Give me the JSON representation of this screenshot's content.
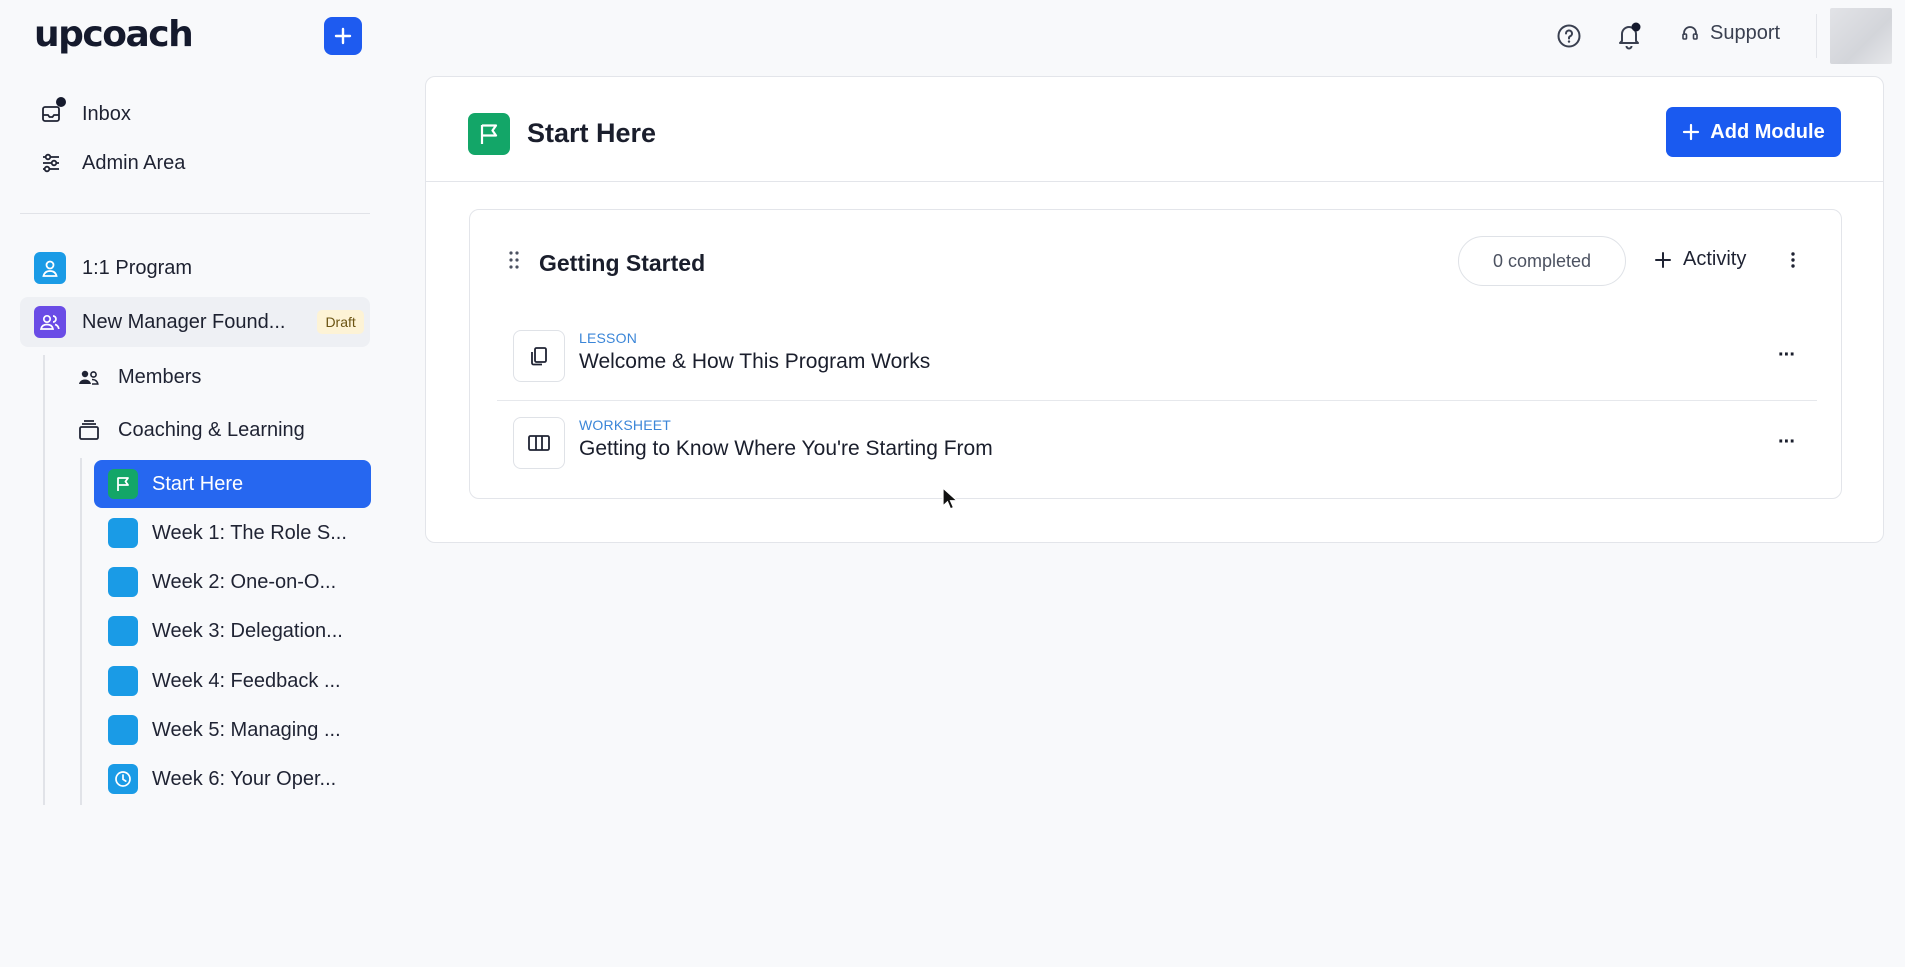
{
  "brand": {
    "logo": "upcoach"
  },
  "topbar": {
    "support_label": "Support"
  },
  "sidebar": {
    "nav": [
      {
        "label": "Inbox",
        "icon": "inbox-icon"
      },
      {
        "label": "Admin Area",
        "icon": "sliders-icon"
      }
    ],
    "programs": [
      {
        "label": "1:1 Program",
        "icon": "user-icon",
        "color": "#1a9be6"
      },
      {
        "label": "New Manager Found...",
        "icon": "users-icon",
        "color": "#6a4ce6",
        "badge": "Draft"
      }
    ],
    "sub": [
      {
        "label": "Members",
        "icon": "members-icon"
      },
      {
        "label": "Coaching & Learning",
        "icon": "stack-icon"
      }
    ],
    "weeks": [
      {
        "label": "Start Here",
        "icon": "flag-icon",
        "color": "#13a668"
      },
      {
        "label": "Week 1: The Role S...",
        "color": "#1a9be6"
      },
      {
        "label": "Week 2: One-on-O...",
        "color": "#1a9be6"
      },
      {
        "label": "Week 3: Delegation...",
        "color": "#1a9be6"
      },
      {
        "label": "Week 4: Feedback ...",
        "color": "#1a9be6"
      },
      {
        "label": "Week 5: Managing ...",
        "color": "#1a9be6"
      },
      {
        "label": "Week 6: Your Oper...",
        "icon": "clock-icon",
        "color": "#1a9be6"
      }
    ]
  },
  "main": {
    "title": "Start Here",
    "add_module_label": "Add Module",
    "module": {
      "title": "Getting Started",
      "completed_label": "0 completed",
      "activity_label": "Activity",
      "items": [
        {
          "type": "LESSON",
          "title": "Welcome & How This Program Works",
          "icon": "copy-icon"
        },
        {
          "type": "WORKSHEET",
          "title": "Getting to Know Where You're Starting From",
          "icon": "columns-icon"
        }
      ],
      "more_label": "···"
    }
  },
  "colors": {
    "accent": "#1a5af0",
    "green": "#13a668",
    "blue": "#1a9be6"
  }
}
